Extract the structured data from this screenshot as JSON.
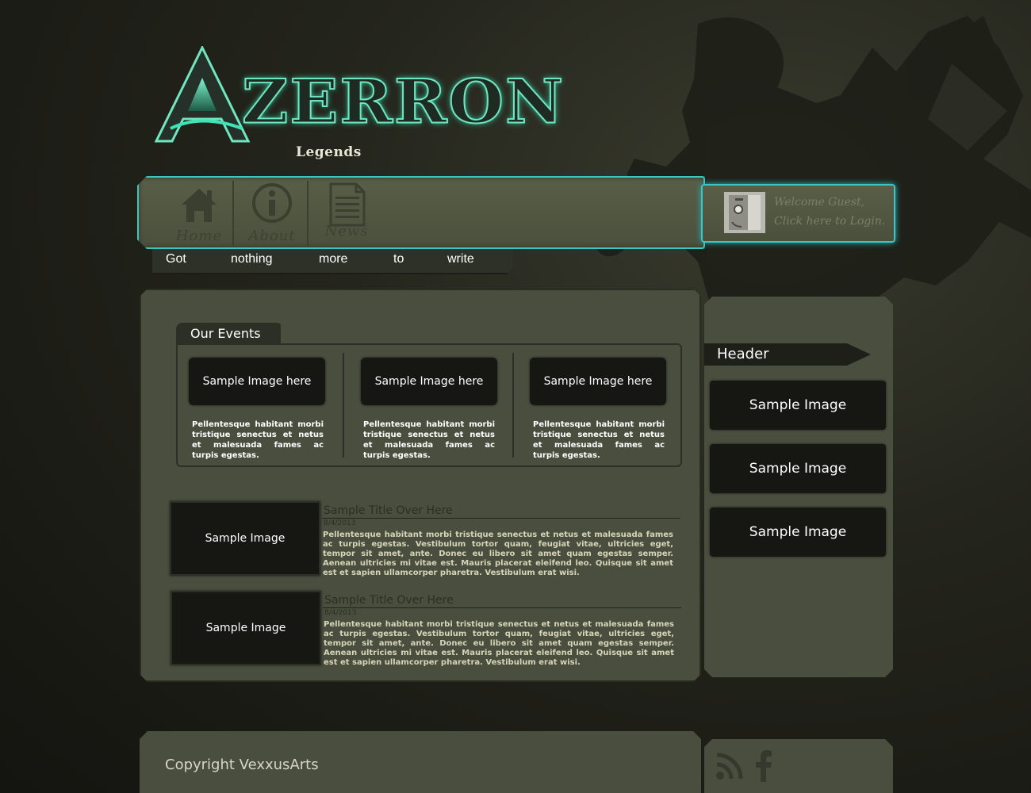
{
  "logo": {
    "letter": "A",
    "wordmark": "ZERRON",
    "subtitle": "Legends"
  },
  "nav": {
    "items": [
      {
        "label": "Home",
        "icon": "home-icon"
      },
      {
        "label": "About",
        "icon": "info-icon"
      },
      {
        "label": "News",
        "icon": "news-icon"
      }
    ]
  },
  "welcome": {
    "line1": "Welcome Guest,",
    "line2": "Click here to Login."
  },
  "subnav": {
    "words": [
      "Got",
      "nothing",
      "more",
      "to",
      "write"
    ]
  },
  "events": {
    "title": "Our Events",
    "items": [
      {
        "image_label": "Sample Image here",
        "text": "Pellentesque habitant morbi tristique senectus et netus et malesuada fames ac turpis egestas."
      },
      {
        "image_label": "Sample Image here",
        "text": "Pellentesque habitant morbi tristique senectus et netus et malesuada fames ac turpis egestas."
      },
      {
        "image_label": "Sample Image here",
        "text": "Pellentesque habitant morbi tristique senectus et netus et malesuada fames ac turpis egestas."
      }
    ]
  },
  "posts": [
    {
      "image_label": "Sample Image",
      "title": "Sample Title Over Here",
      "date": "8/4/2013",
      "body": "Pellentesque habitant morbi tristique senectus et netus et malesuada fames ac turpis egestas. Vestibulum tortor quam, feugiat vitae, ultricies eget, tempor sit amet, ante. Donec eu libero sit amet quam egestas semper. Aenean ultricies mi vitae est. Mauris placerat eleifend leo. Quisque sit amet est et sapien ullamcorper pharetra. Vestibulum erat wisi."
    },
    {
      "image_label": "Sample Image",
      "title": "Sample Title Over Here",
      "date": "8/4/2013",
      "body": "Pellentesque habitant morbi tristique senectus et netus et malesuada fames ac turpis egestas. Vestibulum tortor quam, feugiat vitae, ultricies eget, tempor sit amet, ante. Donec eu libero sit amet quam egestas semper. Aenean ultricies mi vitae est. Mauris placerat eleifend leo. Quisque sit amet est et sapien ullamcorper pharetra. Vestibulum erat wisi."
    }
  ],
  "sidebar": {
    "header": "Header",
    "items": [
      "Sample Image",
      "Sample Image",
      "Sample Image"
    ]
  },
  "footer": {
    "copyright": "Copyright VexxusArts",
    "icons": [
      "rss-icon",
      "facebook-icon"
    ]
  },
  "colors": {
    "accent_glow": "#3cc6c2",
    "panel": "#4a4e3e",
    "dark_box": "#161613"
  }
}
